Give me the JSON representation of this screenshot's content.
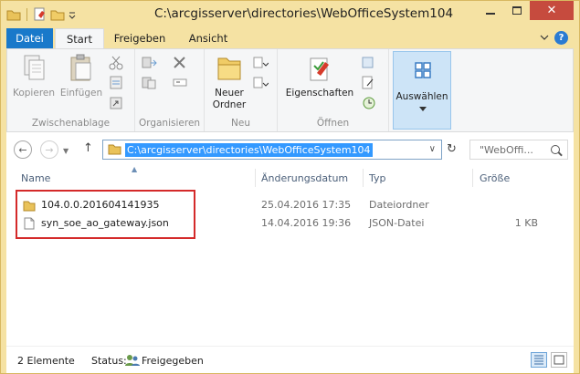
{
  "window": {
    "title": "C:\\arcgisserver\\directories\\WebOfficeSystem104",
    "close_glyph": "✕"
  },
  "tabs": [
    {
      "label": "Datei"
    },
    {
      "label": "Start"
    },
    {
      "label": "Freigeben"
    },
    {
      "label": "Ansicht"
    }
  ],
  "help_glyph": "?",
  "ribbon": {
    "clipboard": {
      "label": "Zwischenablage",
      "copy": "Kopieren",
      "paste": "Einfügen"
    },
    "organize": {
      "label": "Organisieren"
    },
    "new": {
      "label": "Neu",
      "new_folder": "Neuer\nOrdner",
      "new_folder_line1": "Neuer",
      "new_folder_line2": "Ordner"
    },
    "open": {
      "label": "Öffnen",
      "properties": "Eigenschaften"
    },
    "select": {
      "label": "Auswählen"
    }
  },
  "nav": {
    "back_glyph": "←",
    "forward_glyph": "→",
    "up_glyph": "↑",
    "refresh_glyph": "↻",
    "address": "C:\\arcgisserver\\directories\\WebOfficeSystem104",
    "search_placeholder": "\"WebOffi..."
  },
  "columns": {
    "name": "Name",
    "date": "Änderungsdatum",
    "type": "Typ",
    "size": "Größe"
  },
  "files": [
    {
      "name": "104.0.0.201604141935",
      "date": "25.04.2016 17:35",
      "type": "Dateiordner",
      "size": "",
      "icon": "folder-icon"
    },
    {
      "name": "syn_soe_ao_gateway.json",
      "date": "14.04.2016 19:36",
      "type": "JSON-Datei",
      "size": "1 KB",
      "icon": "file-icon"
    }
  ],
  "status": {
    "count": "2 Elemente",
    "status_label": "Status:",
    "shared": "Freigegeben"
  },
  "colors": {
    "titlebar": "#f5e2a3",
    "accent": "#1979ca",
    "close": "#c64b3e",
    "highlight": "#d42a2a",
    "selection": "#3399ff"
  }
}
